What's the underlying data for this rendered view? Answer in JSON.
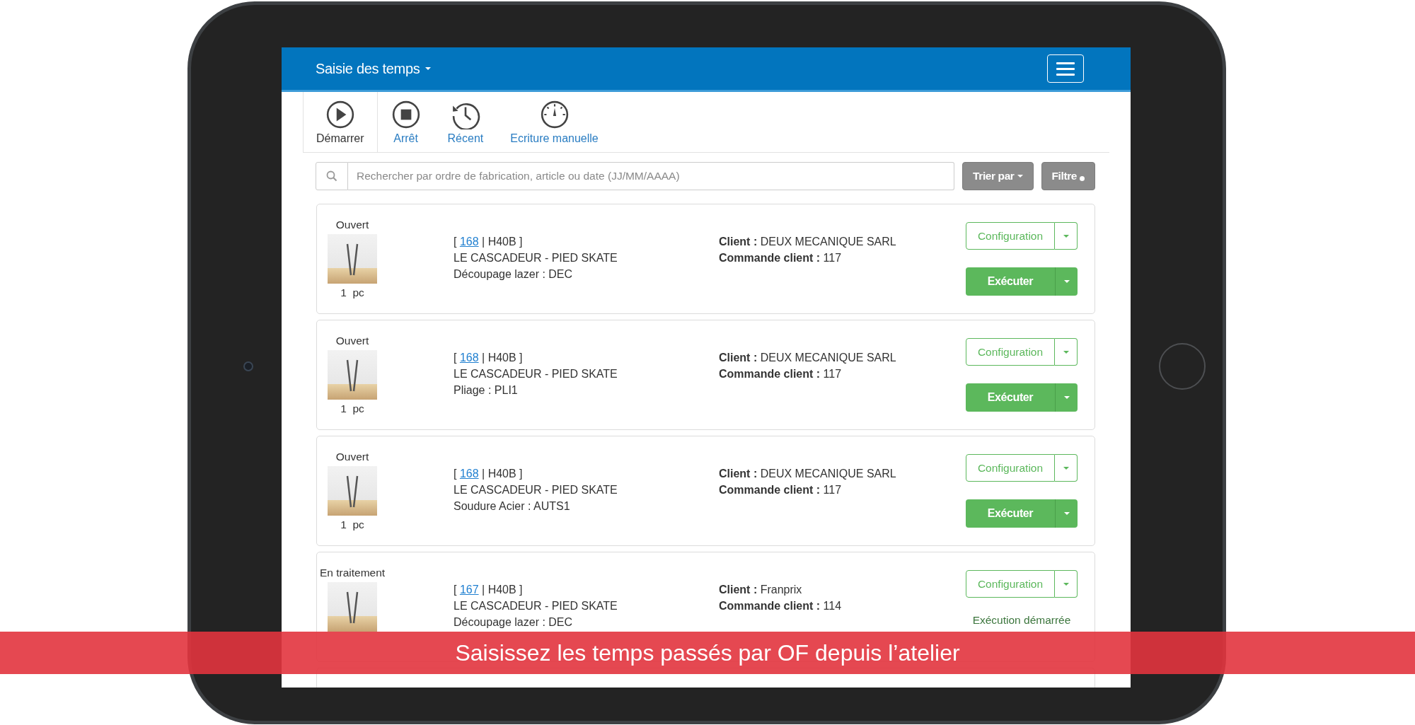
{
  "app_bar": {
    "title": "Saisie des temps"
  },
  "tabs": [
    {
      "label": "Démarrer",
      "selected": true
    },
    {
      "label": "Arrêt",
      "selected": false
    },
    {
      "label": "Récent",
      "selected": false
    },
    {
      "label": "Ecriture manuelle",
      "selected": false
    }
  ],
  "search": {
    "placeholder": "Rechercher par ordre de fabrication, article ou date (JJ/MM/AAAA)"
  },
  "sort_button": "Trier par",
  "filter_button": {
    "label": "Filtre",
    "active": true
  },
  "cards": [
    {
      "status": "Ouvert",
      "quantity": "1  pc",
      "quantity_alert": false,
      "ref_prefix": "[ ",
      "of_number": "168",
      "ref_suffix": " | H40B ]",
      "product": "LE CASCADEUR - PIED SKATE",
      "operation": "Découpage lazer : DEC",
      "client": "**Client :** DEUX MECANIQUE SARL",
      "order": "**Commande client :** 117",
      "config_button": "Configuration",
      "execution": {
        "kind": "button",
        "label": "Exécuter"
      }
    },
    {
      "status": "Ouvert",
      "quantity": "1  pc",
      "quantity_alert": false,
      "ref_prefix": "[ ",
      "of_number": "168",
      "ref_suffix": " | H40B ]",
      "product": "LE CASCADEUR - PIED SKATE",
      "operation": "Pliage : PLI1",
      "client": "**Client :** DEUX MECANIQUE SARL",
      "order": "**Commande client :** 117",
      "config_button": "Configuration",
      "execution": {
        "kind": "button",
        "label": "Exécuter"
      }
    },
    {
      "status": "Ouvert",
      "quantity": "1  pc",
      "quantity_alert": false,
      "ref_prefix": "[ ",
      "of_number": "168",
      "ref_suffix": " | H40B ]",
      "product": "LE CASCADEUR - PIED SKATE",
      "operation": "Soudure Acier : AUTS1",
      "client": "**Client :** DEUX MECANIQUE SARL",
      "order": "**Commande client :** 117",
      "config_button": "Configuration",
      "execution": {
        "kind": "button",
        "label": "Exécuter"
      }
    },
    {
      "status": "En traitement",
      "ref_prefix": "[ ",
      "of_number": "167",
      "ref_suffix": " | H40B ]",
      "product": "LE CASCADEUR - PIED SKATE",
      "operation": "Découpage lazer : DEC",
      "client": "**Client :** Franprix",
      "order": "**Commande client :** 114",
      "config_button": "Configuration",
      "execution": {
        "kind": "started",
        "label": "Exécution démarrée"
      }
    }
  ],
  "caption": "Saisissez les temps passés par OF depuis l’atelier"
}
